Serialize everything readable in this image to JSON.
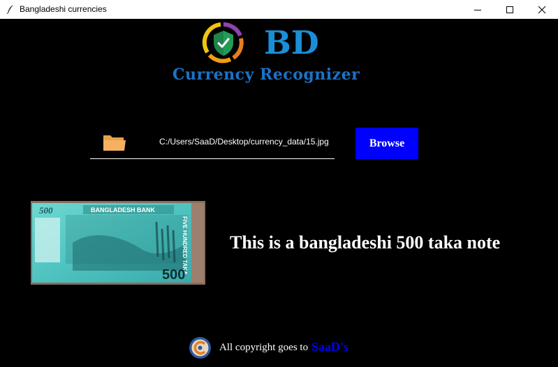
{
  "window": {
    "title": "Bangladeshi currencies",
    "controls": [
      "minimize",
      "maximize",
      "close"
    ]
  },
  "header": {
    "logo_text": "BD",
    "app_title": "Currency Recognizer"
  },
  "file_picker": {
    "path": "C:/Users/SaaD/Desktop/currency_data/15.jpg",
    "browse_label": "Browse"
  },
  "preview": {
    "bank_name": "BANGLADESH BANK",
    "corner_value": "500",
    "side_text": "FIVE HUNDRED TAKA",
    "bottom_value": "500"
  },
  "result": {
    "text": "This is a bangladeshi 500 taka note"
  },
  "footer": {
    "text": "All copyright goes to",
    "author": "SaaD's"
  },
  "colors": {
    "background": "#000000",
    "accent": "#1a73c8",
    "button": "#0000ff",
    "author": "#0000ff"
  }
}
